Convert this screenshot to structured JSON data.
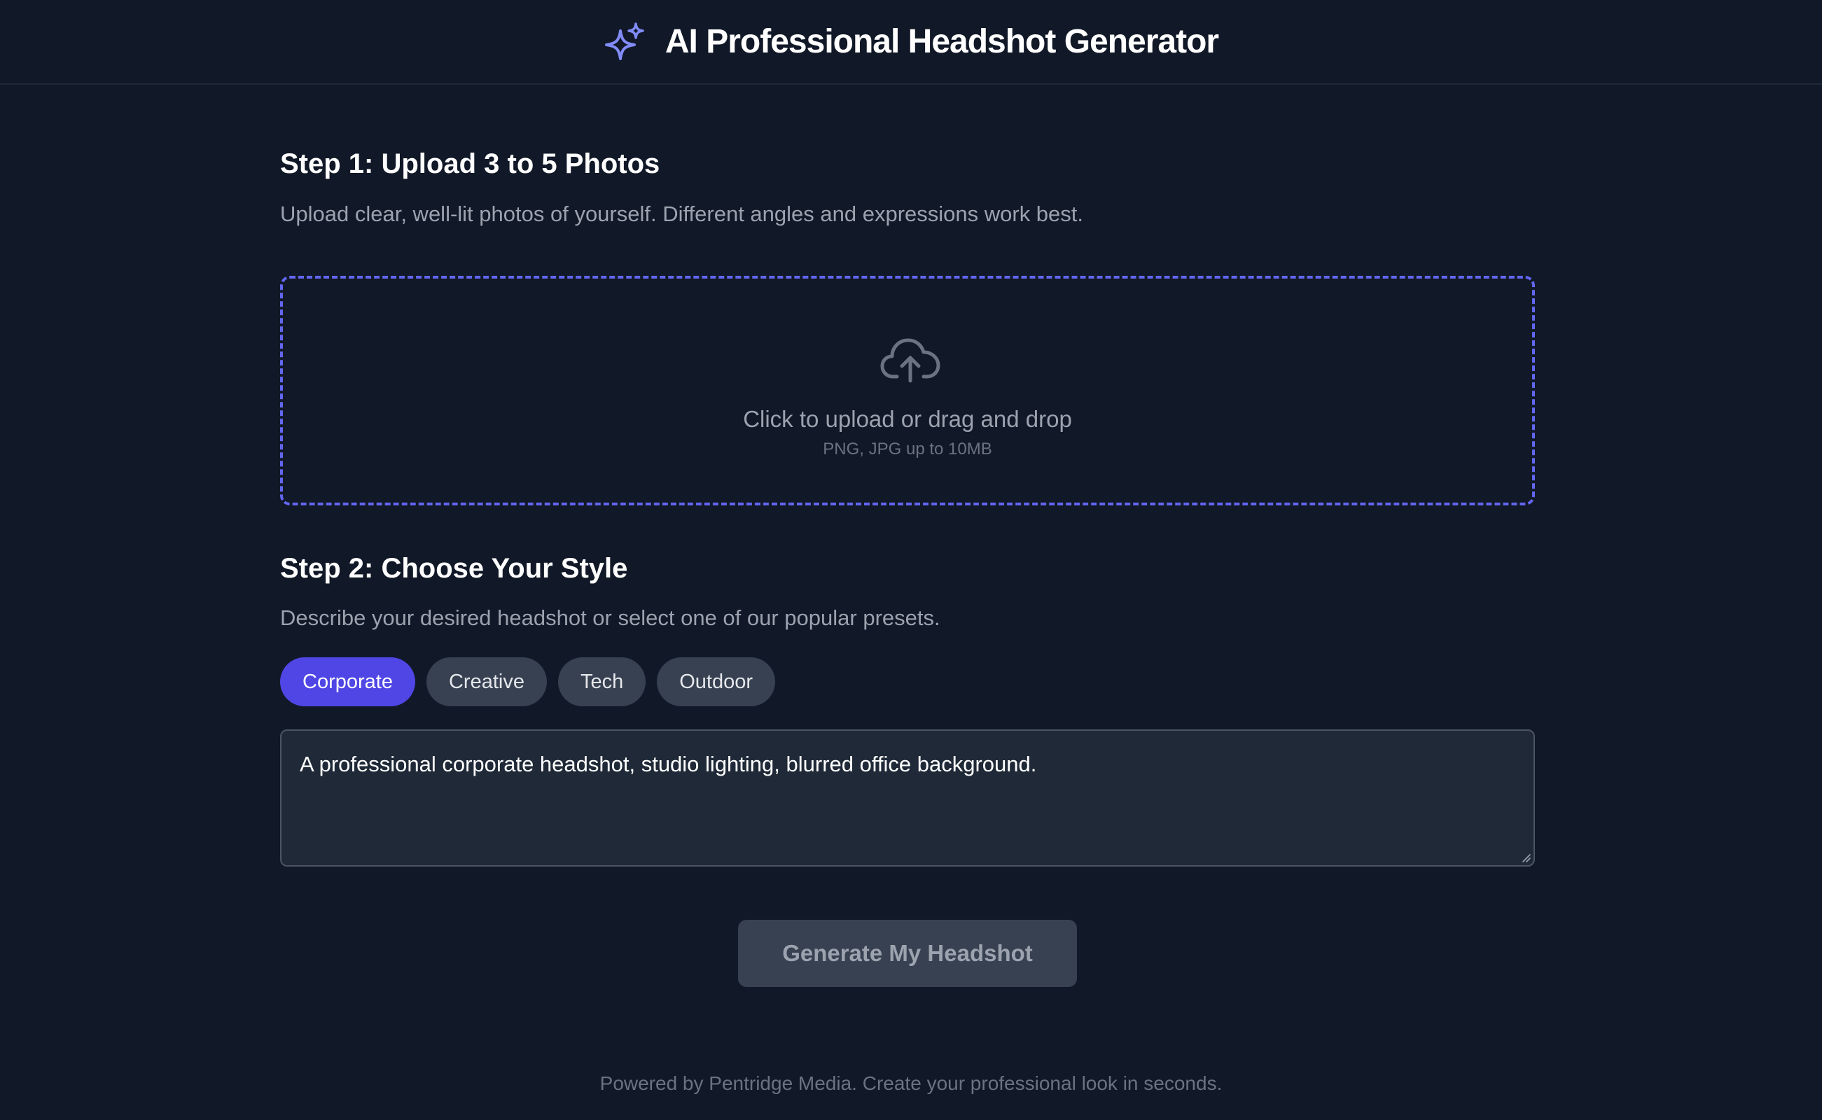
{
  "header": {
    "title": "AI Professional Headshot Generator",
    "icon": "sparkle-icon",
    "icon_color": "#818cf8"
  },
  "step1": {
    "title": "Step 1: Upload 3 to 5 Photos",
    "description": "Upload clear, well-lit photos of yourself. Different angles and expressions work best.",
    "dropzone": {
      "icon": "cloud-upload-icon",
      "title": "Click to upload or drag and drop",
      "subtitle": "PNG, JPG up to 10MB",
      "border_color": "#6366f1"
    }
  },
  "step2": {
    "title": "Step 2: Choose Your Style",
    "description": "Describe your desired headshot or select one of our popular presets.",
    "presets": [
      {
        "label": "Corporate",
        "active": true
      },
      {
        "label": "Creative",
        "active": false
      },
      {
        "label": "Tech",
        "active": false
      },
      {
        "label": "Outdoor",
        "active": false
      }
    ],
    "prompt_value": "A professional corporate headshot, studio lighting, blurred office background."
  },
  "generate_button": {
    "label": "Generate My Headshot",
    "state": "disabled"
  },
  "footer": {
    "text": "Powered by Pentridge Media. Create your professional look in seconds."
  },
  "colors": {
    "background": "#111827",
    "accent": "#4f46e5",
    "surface": "#1f2937",
    "muted_button": "#374151"
  }
}
